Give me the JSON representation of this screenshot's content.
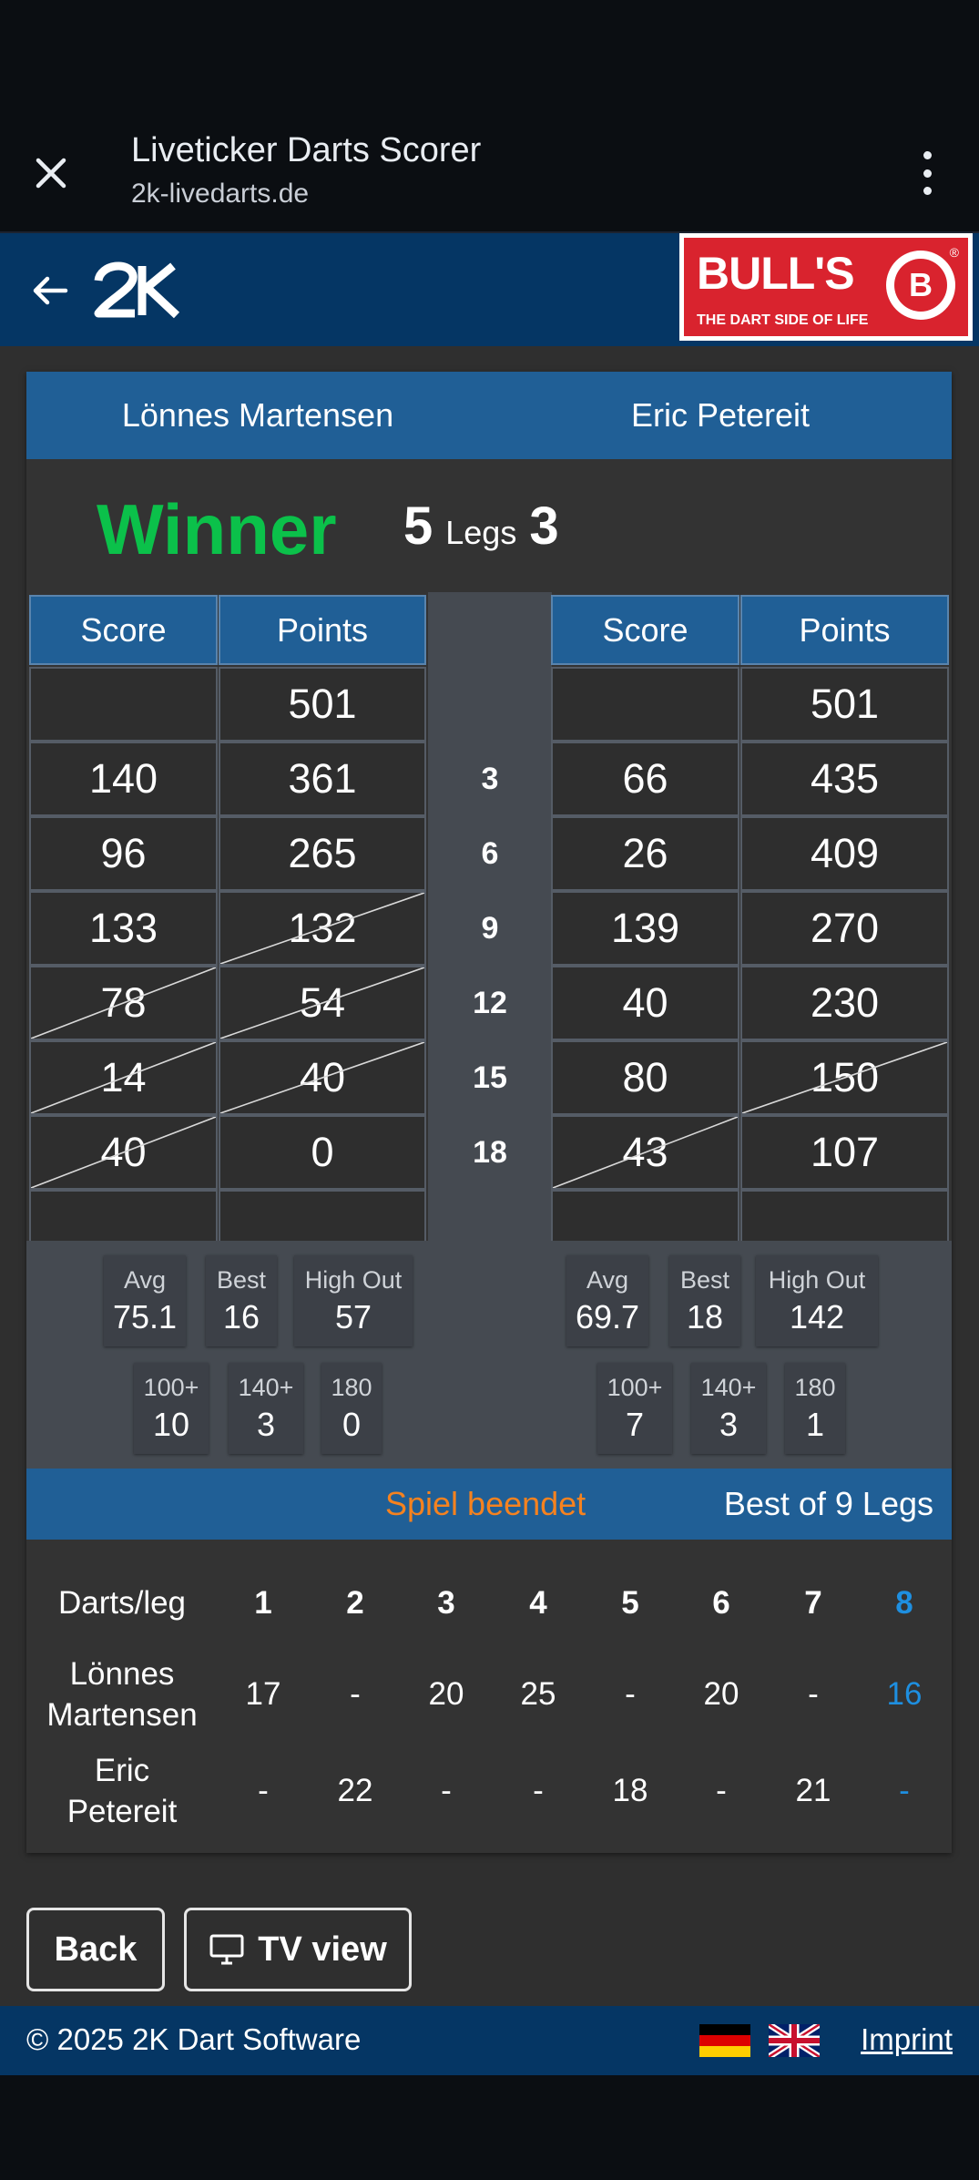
{
  "browser": {
    "title": "Liveticker Darts Scorer",
    "url": "2k-livedarts.de"
  },
  "sponsor": {
    "name": "BULL'S",
    "tagline": "THE DART SIDE OF LIFE",
    "ball_letter": "B",
    "reg_mark": "®"
  },
  "players": {
    "p1": "Lönnes Martensen",
    "p2": "Eric Petereit"
  },
  "result": {
    "winner_label": "Winner",
    "p1_legs": "5",
    "legs_label": "Legs",
    "p2_legs": "3"
  },
  "headers": {
    "score": "Score",
    "points": "Points"
  },
  "rounds": [
    "",
    "3",
    "6",
    "9",
    "12",
    "15",
    "18",
    ""
  ],
  "p1_rows": [
    {
      "score": "",
      "points": "501"
    },
    {
      "score": "140",
      "points": "361"
    },
    {
      "score": "96",
      "points": "265"
    },
    {
      "score": "133",
      "points": "132"
    },
    {
      "score": "78",
      "points": "54"
    },
    {
      "score": "14",
      "points": "40"
    },
    {
      "score": "40",
      "points": "0"
    },
    {
      "score": "",
      "points": ""
    }
  ],
  "p2_rows": [
    {
      "score": "",
      "points": "501"
    },
    {
      "score": "66",
      "points": "435"
    },
    {
      "score": "26",
      "points": "409"
    },
    {
      "score": "139",
      "points": "270"
    },
    {
      "score": "40",
      "points": "230"
    },
    {
      "score": "80",
      "points": "150"
    },
    {
      "score": "43",
      "points": "107"
    },
    {
      "score": "",
      "points": ""
    }
  ],
  "stats": {
    "labels": {
      "avg": "Avg",
      "best": "Best",
      "high_out": "High Out",
      "t100": "100+",
      "t140": "140+",
      "t180": "180"
    },
    "p1": {
      "avg": "75.1",
      "best": "16",
      "high_out": "57",
      "t100": "10",
      "t140": "3",
      "t180": "0"
    },
    "p2": {
      "avg": "69.7",
      "best": "18",
      "high_out": "142",
      "t100": "7",
      "t140": "3",
      "t180": "1"
    }
  },
  "match": {
    "status": "Spiel beendet",
    "format": "Best of 9 Legs"
  },
  "darts_per_leg": {
    "header": "Darts/leg",
    "legs": [
      "1",
      "2",
      "3",
      "4",
      "5",
      "6",
      "7",
      "8"
    ],
    "p1_name_line1": "Lönnes",
    "p1_name_line2": "Martensen",
    "p2_name_line1": "Eric",
    "p2_name_line2": "Petereit",
    "p1": [
      "17",
      "-",
      "20",
      "25",
      "-",
      "20",
      "-",
      "16"
    ],
    "p2": [
      "-",
      "22",
      "-",
      "-",
      "18",
      "-",
      "21",
      "-"
    ],
    "current_leg_color": "#1e8fe0"
  },
  "buttons": {
    "back": "Back",
    "tv_view": "TV view"
  },
  "footer": {
    "copyright": "© 2025 2K Dart Software",
    "imprint": "Imprint"
  },
  "colors": {
    "header_blue": "#205f96",
    "nav_blue": "#053664",
    "winner_green": "#0bc14a",
    "status_orange": "#f5821f"
  }
}
